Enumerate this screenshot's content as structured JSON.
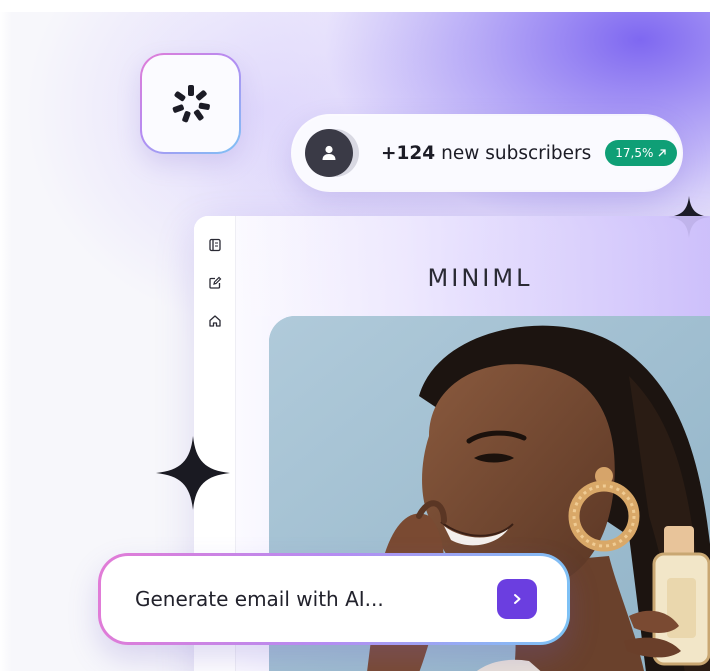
{
  "subscribers": {
    "count": "+124",
    "text": "new subscribers",
    "badge_value": "17,5%",
    "badge_icon": "arrow-up-right-icon",
    "avatar_icon": "user-icon"
  },
  "logo": {
    "icon": "loader-icon"
  },
  "app": {
    "brand": "MINIML",
    "sidebar": [
      {
        "icon": "document-icon"
      },
      {
        "icon": "edit-icon"
      },
      {
        "icon": "home-icon"
      }
    ]
  },
  "prompt": {
    "text": "Generate email with AI...",
    "send_icon": "chevron-right-icon"
  },
  "colors": {
    "accent": "#6b3ee0",
    "badge": "#0f9f76",
    "gradient_start": "#e27bd6",
    "gradient_end": "#7cc3f5",
    "glow": "#7860f0"
  }
}
